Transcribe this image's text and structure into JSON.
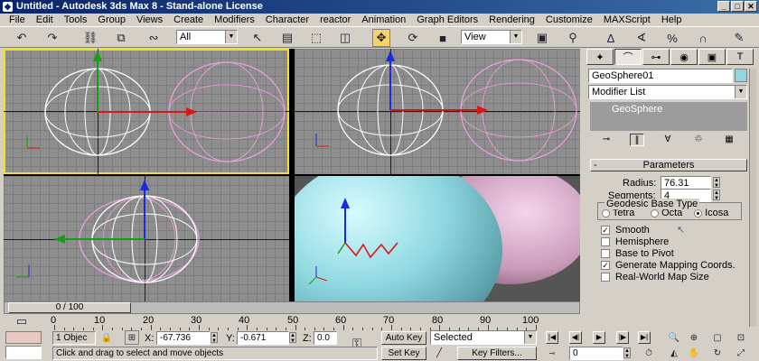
{
  "window": {
    "title": "Untitled - Autodesk 3ds Max 8 - Stand-alone License",
    "min": "_",
    "max": "□",
    "close": "✕"
  },
  "menu": [
    "File",
    "Edit",
    "Tools",
    "Group",
    "Views",
    "Create",
    "Modifiers",
    "Character",
    "reactor",
    "Animation",
    "Graph Editors",
    "Rendering",
    "Customize",
    "MAXScript",
    "Help"
  ],
  "toolbar": {
    "selection_filter": "All",
    "ref_coord": "View"
  },
  "viewports": {
    "count": 4,
    "colors": {
      "object_white": "#ffffff",
      "object_pink": "#f0a0e0",
      "persp_sphere": "#8fd7e0",
      "persp_pink": "#c89ab8",
      "active_border": "#f5e21a"
    }
  },
  "timeline": {
    "frame": "0 / 100",
    "ticks": [
      "0",
      "10",
      "20",
      "30",
      "40",
      "50",
      "60",
      "70",
      "80",
      "90",
      "100"
    ]
  },
  "status": {
    "selection": "1 Objec",
    "x_label": "X:",
    "x_value": "-67.736",
    "y_label": "Y:",
    "y_value": "-0.671",
    "z_label": "Z:",
    "z_value": "0.0",
    "prompt": "Click and drag to select and move objects",
    "auto_key": "Auto Key",
    "set_key": "Set Key",
    "key_mode": "Selected",
    "key_filters": "Key Filters...",
    "current_frame": "0"
  },
  "panel": {
    "object_name": "GeoSphere01",
    "modifier_list": "Modifier List",
    "stack_item": "GeoSphere",
    "parameters_title": "Parameters",
    "radius_label": "Radius:",
    "radius_value": "76.31",
    "segments_label": "Segments:",
    "segments_value": "4",
    "geodesic_label": "Geodesic Base Type",
    "tetra": "Tetra",
    "octa": "Octa",
    "icosa": "Icosa",
    "smooth": "Smooth",
    "hemisphere": "Hemisphere",
    "base_to_pivot": "Base to Pivot",
    "gen_mapping": "Generate Mapping Coords.",
    "real_world": "Real-World Map Size"
  }
}
